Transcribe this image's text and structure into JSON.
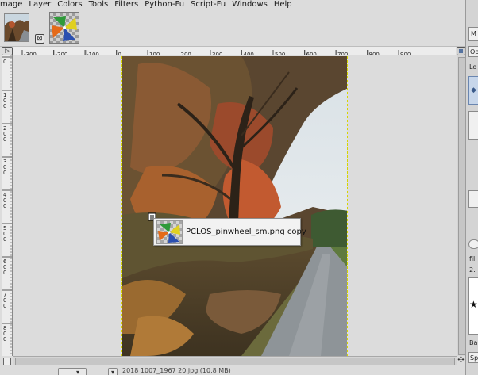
{
  "menubar": {
    "items": [
      "mage",
      "Layer",
      "Colors",
      "Tools",
      "Filters",
      "Python-Fu",
      "Script-Fu",
      "Windows",
      "Help"
    ]
  },
  "tabs": {
    "close_glyph": "⊠"
  },
  "ruler": {
    "h_labels": [
      "-300",
      "-200",
      "-100",
      "0",
      "100",
      "200",
      "300",
      "400",
      "500",
      "600",
      "700",
      "800",
      "900"
    ],
    "v_labels": [
      "0",
      "1 0 0",
      "2 0 0",
      "3 0 0",
      "4 0 0",
      "5 0 0",
      "6 0 0",
      "7 0 0",
      "8 0 0"
    ],
    "corner_glyph": "▷"
  },
  "tooltip": {
    "layer_name": "PCLOS_pinwheel_sm.png copy"
  },
  "statusbar": {
    "unit_arrow": "▾",
    "zoom_prefix": "",
    "zoom_arrow": "▾",
    "text": "2018 1007_1967 20.jpg (10.8 MB)"
  },
  "dock": {
    "labels": [
      "M",
      "Op",
      "Lo",
      "fil",
      "2.",
      "Ba",
      "Sp"
    ]
  },
  "colors": {
    "accent": "#5573a0",
    "canvas_bg": "#dcdcdc",
    "layer_boundary": "#d6d600"
  }
}
